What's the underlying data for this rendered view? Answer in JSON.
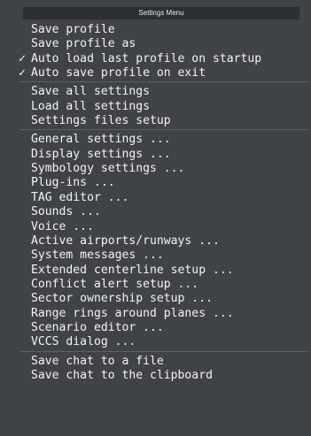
{
  "menu": {
    "title": "Settings Menu",
    "groups": [
      {
        "items": [
          {
            "label": "Save profile",
            "checked": false
          },
          {
            "label": "Save profile as",
            "checked": false
          },
          {
            "label": "Auto load last profile on startup",
            "checked": true
          },
          {
            "label": "Auto save profile on exit",
            "checked": true
          }
        ]
      },
      {
        "items": [
          {
            "label": "Save all settings",
            "checked": false
          },
          {
            "label": "Load all settings",
            "checked": false
          },
          {
            "label": "Settings files setup",
            "checked": false
          }
        ]
      },
      {
        "items": [
          {
            "label": "General settings ...",
            "checked": false
          },
          {
            "label": "Display settings ...",
            "checked": false
          },
          {
            "label": "Symbology settings ...",
            "checked": false
          },
          {
            "label": "Plug-ins ...",
            "checked": false
          },
          {
            "label": "TAG editor ...",
            "checked": false
          },
          {
            "label": "Sounds ...",
            "checked": false
          },
          {
            "label": "Voice ...",
            "checked": false
          },
          {
            "label": "Active airports/runways ...",
            "checked": false
          },
          {
            "label": "System messages ...",
            "checked": false
          },
          {
            "label": "Extended centerline setup ...",
            "checked": false
          },
          {
            "label": "Conflict alert setup ...",
            "checked": false
          },
          {
            "label": "Sector ownership setup ...",
            "checked": false
          },
          {
            "label": "Range rings around planes ...",
            "checked": false
          },
          {
            "label": "Scenario editor ...",
            "checked": false
          },
          {
            "label": "VCCS dialog ...",
            "checked": false
          }
        ]
      },
      {
        "items": [
          {
            "label": "Save chat to a file",
            "checked": false
          },
          {
            "label": "Save chat to the clipboard",
            "checked": false
          }
        ]
      }
    ]
  },
  "checkmark_glyph": "✓",
  "colors": {
    "background": "#3f4247",
    "title_bar": "#2c2e33",
    "text": "#f4f4f4",
    "separator": "#5b5e64"
  }
}
